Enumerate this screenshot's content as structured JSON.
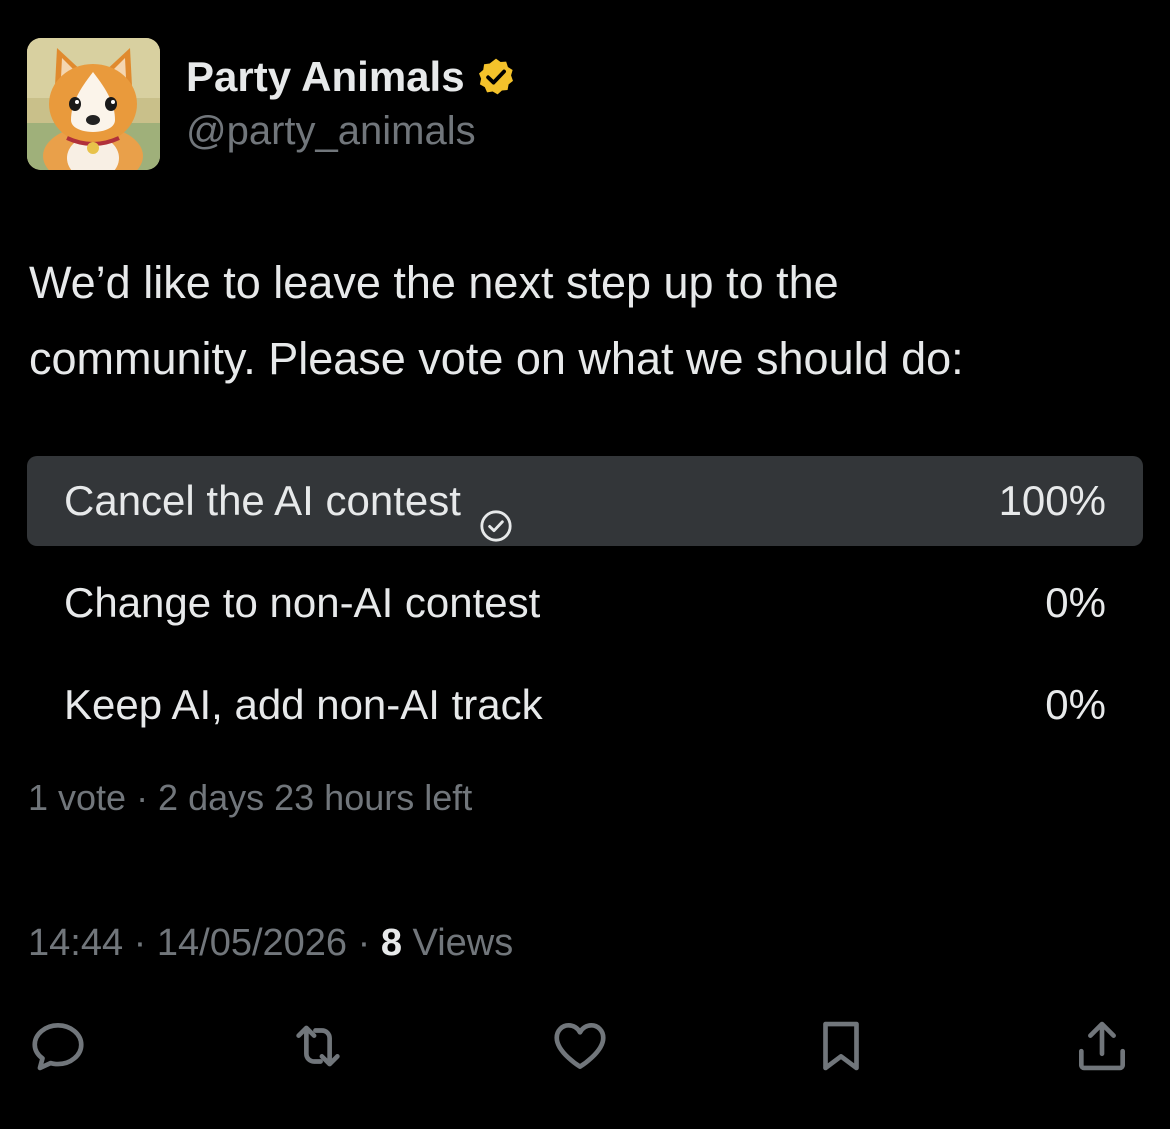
{
  "account": {
    "display_name": "Party Animals",
    "handle": "@party_animals",
    "verified_icon": "verified-badge-icon",
    "verified_color": "#f4c22b"
  },
  "tweet": {
    "text_line_1": "We’d like to leave the next step up to the",
    "text_line_2": "community. Please vote on what we should do:"
  },
  "poll": {
    "options": [
      {
        "label": "Cancel the AI contest",
        "percent": "100%",
        "fraction": 1.0,
        "selected": true
      },
      {
        "label": "Change to non-AI contest",
        "percent": "0%",
        "fraction": 0.0,
        "selected": false
      },
      {
        "label": "Keep AI, add non-AI track",
        "percent": "0%",
        "fraction": 0.0,
        "selected": false
      }
    ],
    "meta": "1 vote · 2 days 23 hours left"
  },
  "meta": {
    "time": "14:44",
    "sep1": " · ",
    "date": "14/05/2026",
    "sep2": " · ",
    "views_count": "8",
    "views_label": " Views"
  },
  "actions": [
    "reply-icon",
    "retweet-icon",
    "like-icon",
    "bookmark-icon",
    "share-icon"
  ],
  "colors": {
    "background": "#000000",
    "text": "#e7e9ea",
    "muted": "#71767b",
    "poll_fill": "#333639"
  }
}
